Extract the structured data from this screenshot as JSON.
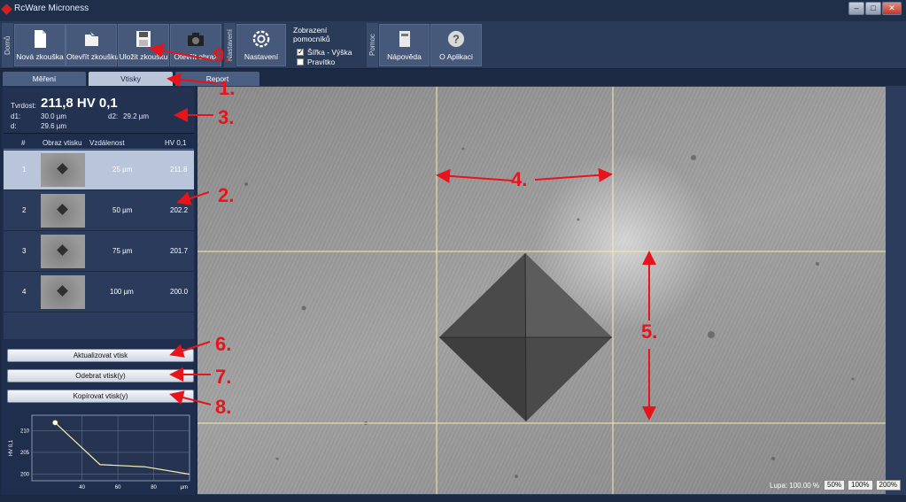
{
  "window": {
    "title": "RcWare Microness",
    "min": "–",
    "max": "□",
    "close": "✕"
  },
  "ribbon": {
    "groups": {
      "home": "Domů",
      "settings": "Nastavení",
      "help": "Pomoc"
    },
    "buttons": {
      "new_test": "Nová zkouška",
      "open_test": "Otevřít zkoušku",
      "save_test": "Uložit zkoušku",
      "open_image": "Otevřít obraz",
      "settings": "Nastavení",
      "help": "Nápověda",
      "about": "O Aplikaci"
    },
    "helpers": {
      "title": "Zobrazení pomocníků",
      "width_height": "Šířka - Výška",
      "ruler": "Pravítko",
      "width_height_checked": true,
      "ruler_checked": false
    }
  },
  "tabs": [
    "Měření",
    "Vtisky",
    "Report"
  ],
  "active_tab": "Vtisky",
  "hardness": {
    "label": "Tvrdost:",
    "value": "211,8 HV 0,1",
    "d1_label": "d1:",
    "d1": "30.0 µm",
    "d2_label": "d2:",
    "d2": "29.2 µm",
    "d_label": "d:",
    "d": "29.6 µm"
  },
  "table": {
    "headers": [
      "#",
      "Obraz vtisku",
      "Vzdálenost",
      "HV 0,1"
    ],
    "rows": [
      {
        "num": "1",
        "distance": "25 µm",
        "hv": "211.8",
        "selected": true
      },
      {
        "num": "2",
        "distance": "50 µm",
        "hv": "202.2",
        "selected": false
      },
      {
        "num": "3",
        "distance": "75 µm",
        "hv": "201.7",
        "selected": false
      },
      {
        "num": "4",
        "distance": "100 µm",
        "hv": "200.0",
        "selected": false
      }
    ]
  },
  "actions": {
    "update": "Aktualizovat vtisk",
    "remove": "Odebrat vtisk(y)",
    "copy": "Kopírovat vtisk(y)"
  },
  "chart_data": {
    "type": "line",
    "x": [
      25,
      50,
      75,
      100
    ],
    "values": [
      211.8,
      202.2,
      201.7,
      200.0
    ],
    "ylabel": "HV 0,1",
    "xunit": "µm",
    "xticks": [
      40,
      60,
      80
    ],
    "yticks": [
      200,
      205,
      210
    ],
    "xlim": [
      12,
      100
    ],
    "ylim": [
      198.5,
      213.5
    ],
    "grid": true,
    "line_color": "#f5f0b0"
  },
  "viewer": {
    "zoom_label": "Lupa: 100.00 %",
    "zoom_buttons": [
      "50%",
      "100%",
      "200%"
    ]
  },
  "annotations": [
    "1.",
    "2.",
    "3.",
    "4.",
    "5.",
    "6.",
    "7.",
    "8.",
    "9."
  ],
  "colors": {
    "accent_red": "#e8141b",
    "panel": "#1f2e4c",
    "ribbon": "#2a3b58"
  }
}
